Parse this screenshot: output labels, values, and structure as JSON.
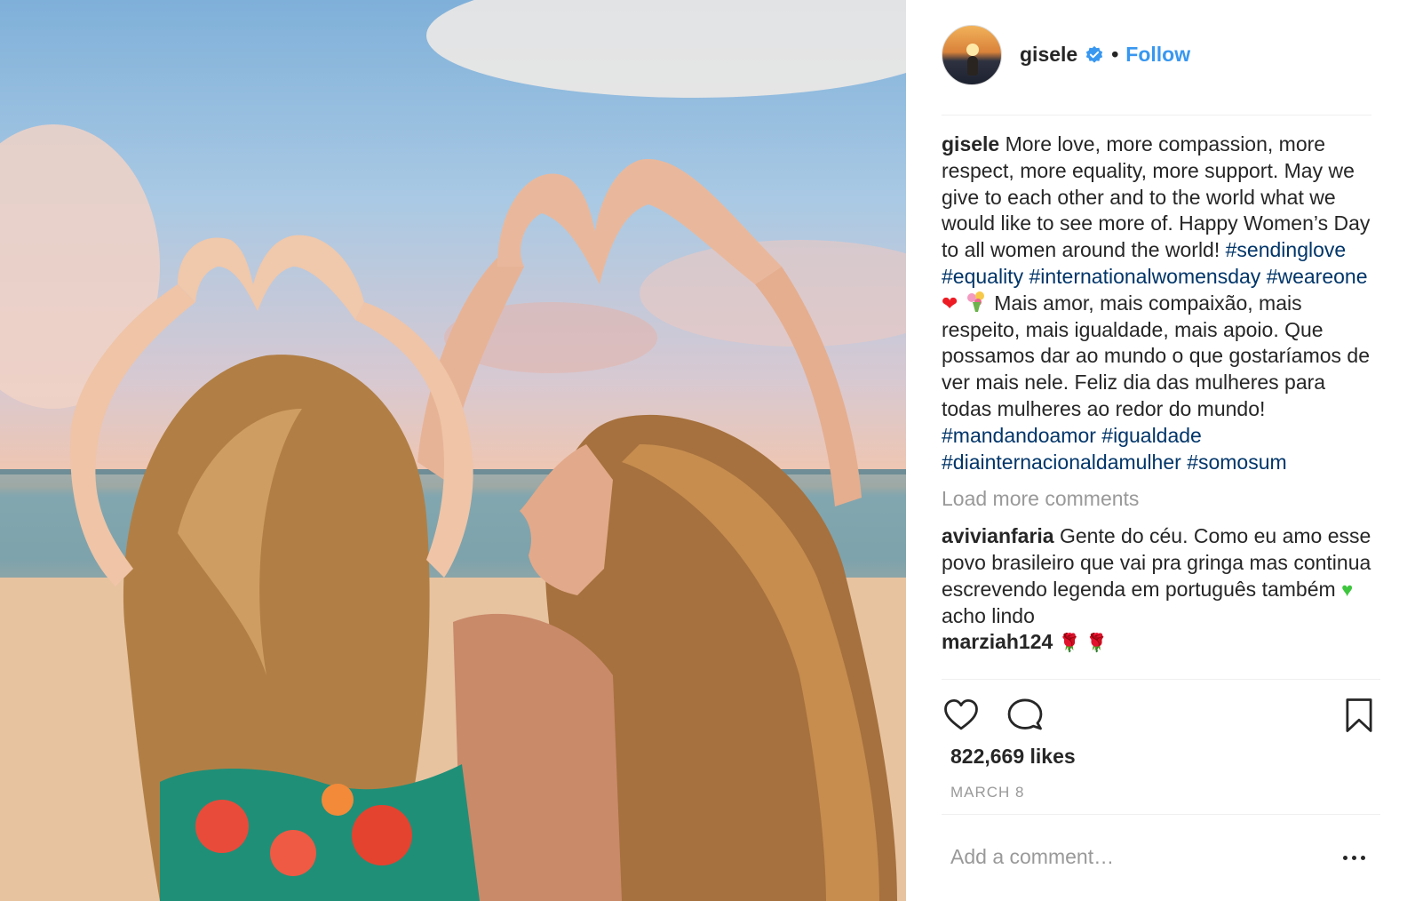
{
  "post": {
    "photo": {
      "icon": "photo"
    },
    "author": {
      "username": "gisele",
      "verified_icon": "verified-badge-icon",
      "separator": "•",
      "follow_label": "Follow"
    },
    "caption": {
      "author": "gisele",
      "text_1": "More love, more compassion, more respect, more equality, more support. May we give to each other and to the world what we would like to see more of. Happy Women’s Day to all women around the world!",
      "tags_1": [
        "#sendinglove",
        "#equality",
        "#internationalwomensday",
        "#weareone"
      ],
      "emoji_heart": "❤",
      "text_2": "Mais amor, mais compaixão, mais respeito, mais igualdade, mais apoio. Que possamos dar ao mundo o que gostaríamos de ver mais nele. Feliz dia das mulheres para todas mulheres ao redor do mundo!",
      "tags_2": [
        "#mandandoamor",
        "#igualdade",
        "#diainternacionaldamulher",
        "#somosum"
      ]
    },
    "load_more_label": "Load more comments",
    "comments": [
      {
        "author": "avivianfaria",
        "text_1": "Gente do céu. Como eu amo esse povo brasileiro que vai pra gringa mas continua escrevendo legenda em português também",
        "emoji": "♥",
        "text_2": "acho lindo"
      },
      {
        "author": "marziah124",
        "emoji": "🌹 🌹"
      }
    ],
    "actions": {
      "like_icon": "heart-outline-icon",
      "comment_icon": "comment-bubble-icon",
      "save_icon": "bookmark-icon"
    },
    "likes_label": "822,669 likes",
    "date": "MARCH 8",
    "add_comment": {
      "placeholder": "Add a comment…",
      "more_icon": "more-options-icon"
    }
  },
  "colors": {
    "link_blue": "#3897f0",
    "hashtag": "#003569",
    "muted": "#999999",
    "text": "#262626",
    "divider": "#efefef"
  }
}
